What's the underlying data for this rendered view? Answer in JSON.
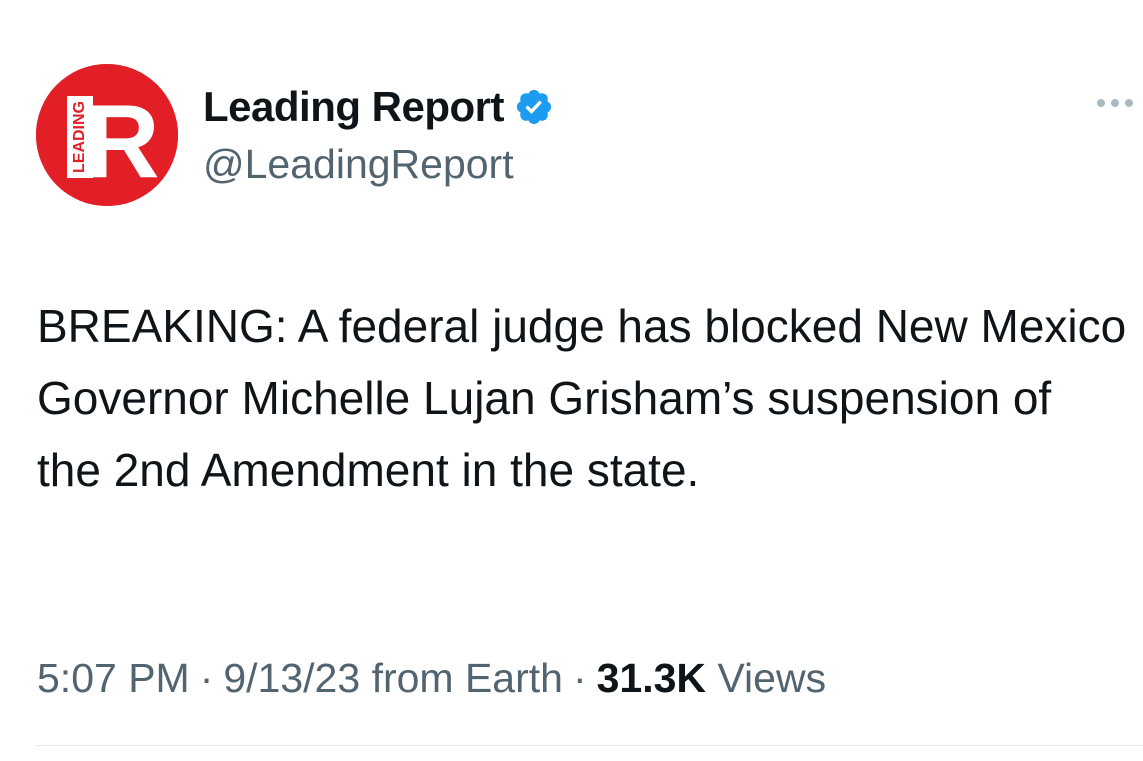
{
  "account": {
    "display_name": "Leading Report",
    "handle": "@LeadingReport",
    "verified": true,
    "avatar": {
      "icon": "leading-report-logo-icon",
      "logo_letter": "R",
      "logo_word": "LEADING",
      "color": "#e21e26"
    }
  },
  "tweet": {
    "text": "BREAKING: A federal judge has blocked New Mexico Governor Michelle Lujan Grisham’s suspension of the 2nd Amendment in the state.",
    "time": "5:07 PM",
    "date": "9/13/23",
    "source": "from Earth",
    "views_count": "31.3K",
    "views_label": "Views"
  },
  "colors": {
    "text_primary": "#0f1419",
    "text_secondary": "#536471",
    "verified_blue": "#1d9bf0",
    "divider": "#e1e8ed"
  },
  "icons": {
    "verified": "verified-badge-icon",
    "more": "more-options-icon"
  }
}
